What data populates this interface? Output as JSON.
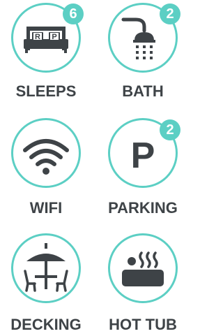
{
  "colors": {
    "accent": "#5ccfc4",
    "icon": "#3e4347",
    "text": "#3e4347"
  },
  "amenities": [
    {
      "label": "SLEEPS",
      "icon": "bed-icon",
      "badge": "6",
      "bed_letters": [
        "R",
        "P"
      ]
    },
    {
      "label": "BATH",
      "icon": "shower-icon",
      "badge": "2"
    },
    {
      "label": "WIFI",
      "icon": "wifi-icon"
    },
    {
      "label": "PARKING",
      "icon": "parking-icon",
      "badge": "2",
      "icon_text": "P"
    },
    {
      "label": "DECKING",
      "icon": "patio-table-icon"
    },
    {
      "label": "HOT TUB",
      "icon": "hot-tub-icon"
    }
  ]
}
